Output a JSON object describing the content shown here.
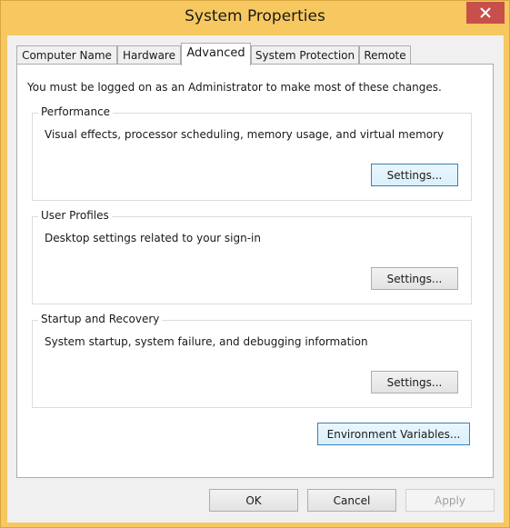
{
  "window": {
    "title": "System Properties",
    "close_icon": "close-icon"
  },
  "tabs": [
    {
      "label": "Computer Name",
      "active": false
    },
    {
      "label": "Hardware",
      "active": false
    },
    {
      "label": "Advanced",
      "active": true
    },
    {
      "label": "System Protection",
      "active": false
    },
    {
      "label": "Remote",
      "active": false
    }
  ],
  "advanced": {
    "notice": "You must be logged on as an Administrator to make most of these changes.",
    "performance": {
      "legend": "Performance",
      "description": "Visual effects, processor scheduling, memory usage, and virtual memory",
      "button": "Settings..."
    },
    "user_profiles": {
      "legend": "User Profiles",
      "description": "Desktop settings related to your sign-in",
      "button": "Settings..."
    },
    "startup_recovery": {
      "legend": "Startup and Recovery",
      "description": "System startup, system failure, and debugging information",
      "button": "Settings..."
    },
    "env_button": "Environment Variables..."
  },
  "footer": {
    "ok": "OK",
    "cancel": "Cancel",
    "apply": "Apply"
  },
  "colors": {
    "title_bar": "#f6c85f",
    "close_button": "#c7504a",
    "focus_border": "#3c7fb1"
  }
}
